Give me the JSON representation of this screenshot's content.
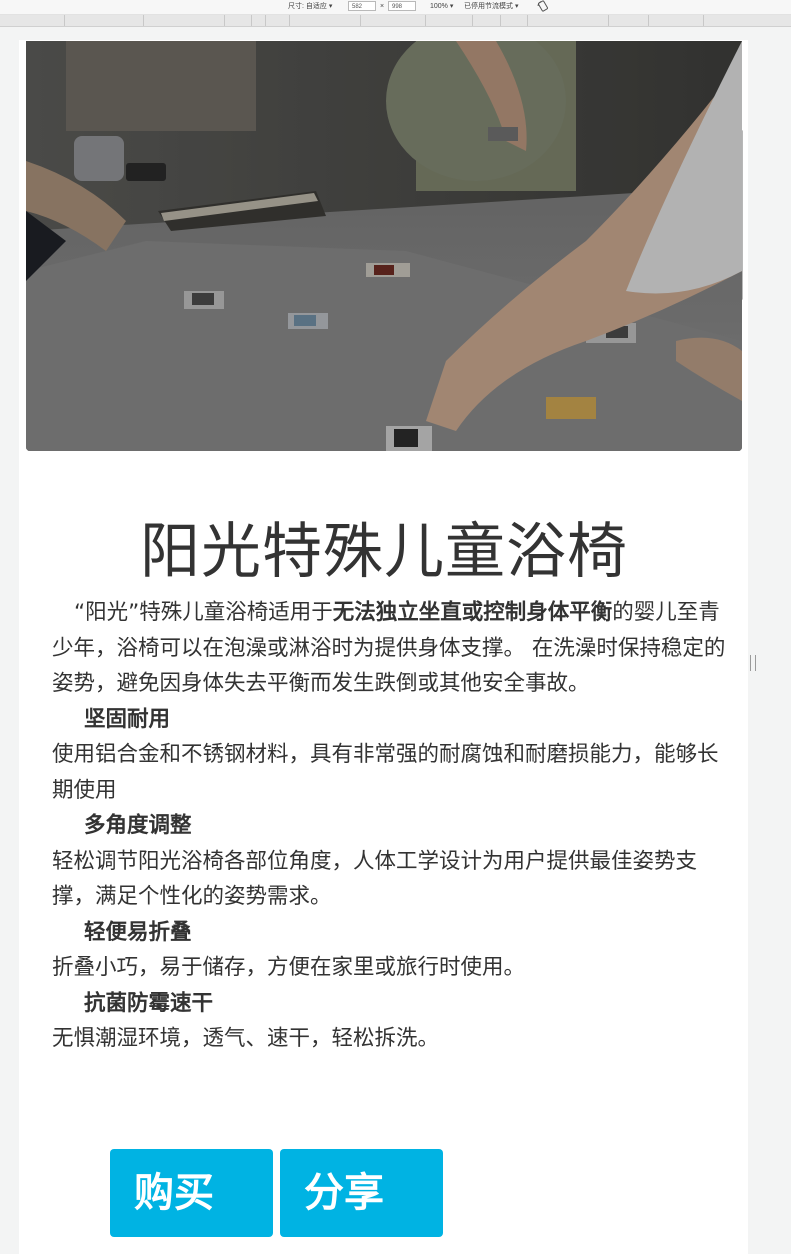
{
  "toolbar": {
    "size_label": "尺寸: 自适应 ▾",
    "width_value": "582",
    "times": "×",
    "height_value": "998",
    "zoom": "100% ▾",
    "throttle": "已停用节流模式 ▾",
    "rotate_icon": "rotate-icon"
  },
  "product": {
    "title": "阳光特殊儿童浴椅",
    "intro_pre": "“阳光”特殊儿童浴椅适用于",
    "intro_bold": "无法独立坐直或控制身体平衡",
    "intro_post": "的婴儿至青少年，浴椅可以在泡澡或淋浴时为提供身体支撑。 在洗澡时保持稳定的姿势，避免因身体失去平衡而发生跌倒或其他安全事故。",
    "features": [
      {
        "heading": "坚固耐用",
        "text": "使用铝合金和不锈钢材料，具有非常强的耐腐蚀和耐磨损能力，能够长期使用"
      },
      {
        "heading": "多角度调整",
        "text": "轻松调节阳光浴椅各部位角度，人体工学设计为用户提供最佳姿势支撑，满足个性化的姿势需求。"
      },
      {
        "heading": "轻便易折叠",
        "text": "折叠小巧，易于储存，方便在家里或旅行时使用。"
      },
      {
        "heading": "抗菌防霉速干",
        "text": "无惧潮湿环境，透气、速干，轻松拆洗。"
      }
    ]
  },
  "actions": {
    "buy_label": "购买",
    "share_label": "分享"
  },
  "colors": {
    "button": "#00b3e3",
    "text": "#333333"
  }
}
